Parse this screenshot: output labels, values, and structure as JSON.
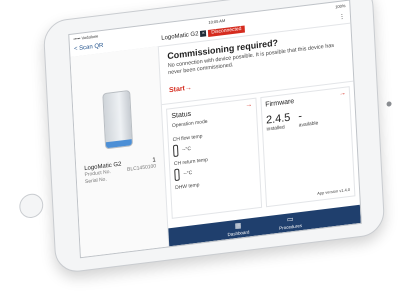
{
  "status_bar": {
    "carrier": "••••• Vodafone",
    "time": "10:05 AM",
    "battery": "100%"
  },
  "nav": {
    "back_label": "< Scan QR",
    "device": "LogoMatic G2",
    "close": "×",
    "status": "Disconnected",
    "menu": "⋮"
  },
  "device": {
    "name": "LogoMatic G2",
    "name_value": "1",
    "details": [
      {
        "label": "Product No.",
        "value": "BLC1450100"
      },
      {
        "label": "Serial No.",
        "value": ""
      }
    ]
  },
  "commission": {
    "title": "Commissioning required?",
    "text": "No connection with device possible. It is possible that this device has never been commissioned.",
    "start": "Start→"
  },
  "status_card": {
    "title": "Status",
    "arrow": "→",
    "mode": "Operation mode",
    "temps": [
      {
        "label": "CH flow temp",
        "value": "--°C"
      },
      {
        "label": "CH return temp",
        "value": "--°C"
      },
      {
        "label": "DHW temp",
        "value": ""
      }
    ]
  },
  "firmware_card": {
    "title": "Firmware",
    "arrow": "→",
    "installed": {
      "value": "2.4.5",
      "label": "installed"
    },
    "available": {
      "value": "-",
      "label": "available"
    },
    "app_version": "App version v1.4.0"
  },
  "tabs": [
    {
      "icon": "grid-icon",
      "label": "Dashboard"
    },
    {
      "icon": "document-icon",
      "label": "Procedures"
    }
  ],
  "colors": {
    "accent": "#d52b1e",
    "tabbar": "#1f3f6d",
    "link": "#1e4f8a"
  }
}
